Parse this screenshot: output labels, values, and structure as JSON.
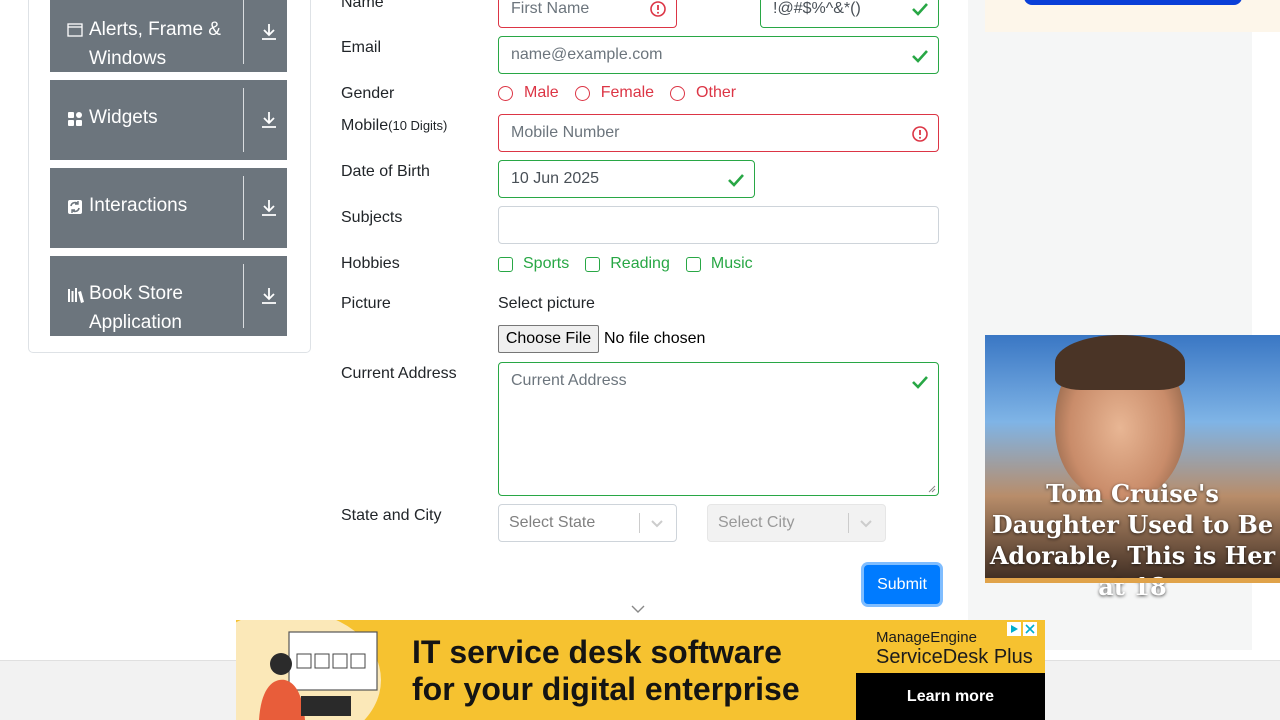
{
  "sidebar": {
    "items": [
      {
        "label": "Alerts, Frame & Windows",
        "icon": "window-icon"
      },
      {
        "label": "Widgets",
        "icon": "widgets-icon"
      },
      {
        "label": "Interactions",
        "icon": "interactions-icon"
      },
      {
        "label": "Book Store Application",
        "icon": "books-icon"
      }
    ]
  },
  "form": {
    "name_label": "Name",
    "first_name_placeholder": "First Name",
    "last_name_value": "!@#$%^&*()",
    "email_label": "Email",
    "email_placeholder": "name@example.com",
    "gender_label": "Gender",
    "gender_options": [
      "Male",
      "Female",
      "Other"
    ],
    "mobile_label": "Mobile",
    "mobile_hint": "(10 Digits)",
    "mobile_placeholder": "Mobile Number",
    "dob_label": "Date of Birth",
    "dob_value": "10 Jun 2025",
    "subjects_label": "Subjects",
    "subjects_value": "",
    "hobbies_label": "Hobbies",
    "hobbies_options": [
      "Sports",
      "Reading",
      "Music"
    ],
    "picture_label": "Picture",
    "picture_hint": "Select picture",
    "file_button": "Choose File",
    "file_status": "No file chosen",
    "address_label": "Current Address",
    "address_placeholder": "Current Address",
    "state_city_label": "State and City",
    "state_placeholder": "Select State",
    "city_placeholder": "Select City",
    "submit_label": "Submit"
  },
  "promo": {
    "caption": "Tom Cruise's Daughter Used to Be Adorable, This is Her at 18"
  },
  "ad": {
    "headline_line1": "IT service desk software",
    "headline_line2": "for your digital enterprise",
    "brand_top": "ManageEngine",
    "brand_bottom": "ServiceDesk Plus",
    "cta": "Learn more"
  },
  "colors": {
    "valid": "#28a745",
    "invalid": "#dc3545",
    "primary": "#007bff",
    "nav_card": "#6c757d",
    "ad_bg": "#f6c230"
  }
}
